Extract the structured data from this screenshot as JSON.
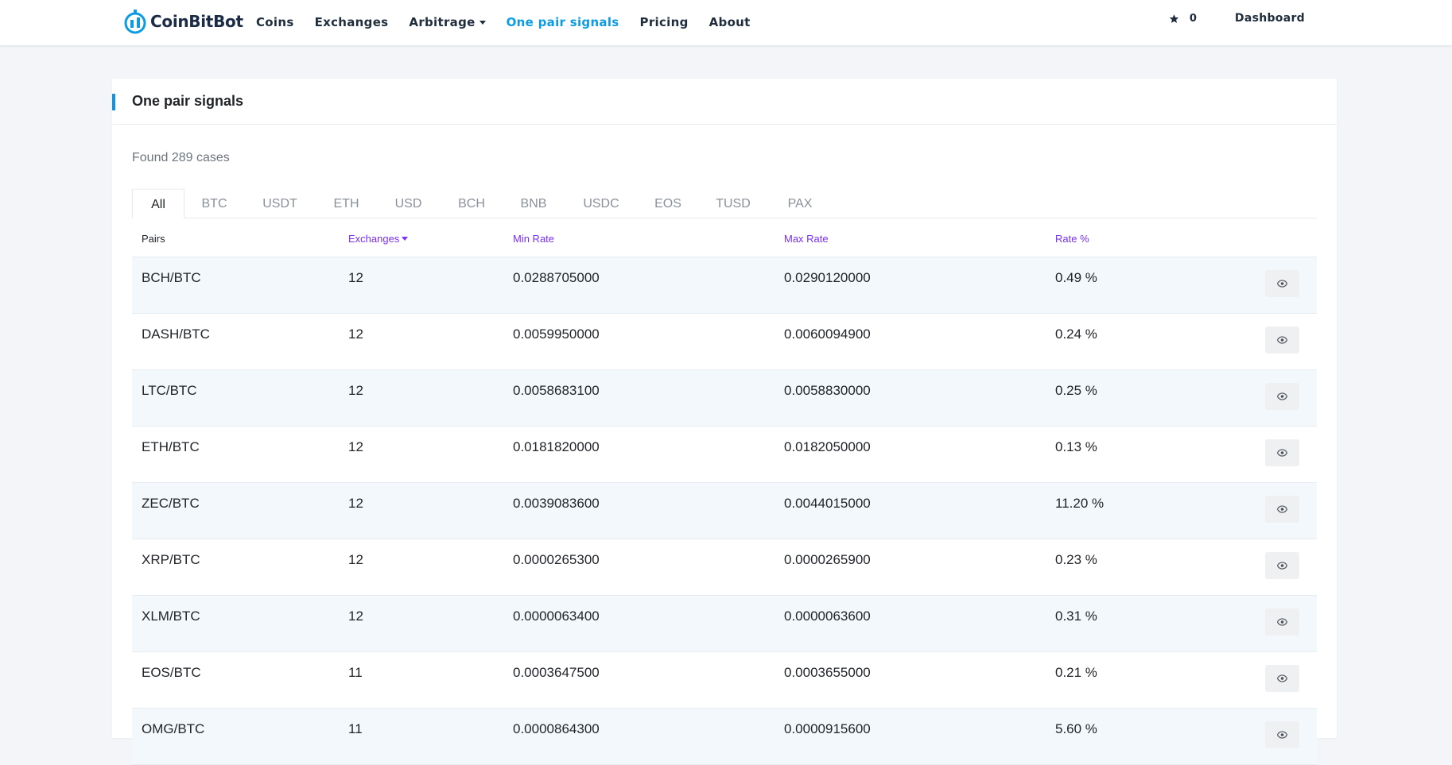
{
  "brand": {
    "name": "CoinBitBot"
  },
  "nav": {
    "coins": "Coins",
    "exchanges": "Exchanges",
    "arbitrage": "Arbitrage",
    "one_pair": "One pair signals",
    "pricing": "Pricing",
    "about": "About"
  },
  "header_right": {
    "favorites_count": "0",
    "dashboard": "Dashboard"
  },
  "page": {
    "title": "One pair signals",
    "found": "Found 289 cases"
  },
  "tabs": [
    "All",
    "BTC",
    "USDT",
    "ETH",
    "USD",
    "BCH",
    "BNB",
    "USDC",
    "EOS",
    "TUSD",
    "PAX"
  ],
  "table": {
    "headers": {
      "pairs": "Pairs",
      "exchanges": "Exchanges",
      "min_rate": "Min Rate",
      "max_rate": "Max Rate",
      "rate_pct": "Rate %"
    },
    "rows": [
      {
        "pair": "BCH/BTC",
        "exchanges": "12",
        "min": "0.0288705000",
        "max": "0.0290120000",
        "pct": "0.49 %"
      },
      {
        "pair": "DASH/BTC",
        "exchanges": "12",
        "min": "0.0059950000",
        "max": "0.0060094900",
        "pct": "0.24 %"
      },
      {
        "pair": "LTC/BTC",
        "exchanges": "12",
        "min": "0.0058683100",
        "max": "0.0058830000",
        "pct": "0.25 %"
      },
      {
        "pair": "ETH/BTC",
        "exchanges": "12",
        "min": "0.0181820000",
        "max": "0.0182050000",
        "pct": "0.13 %"
      },
      {
        "pair": "ZEC/BTC",
        "exchanges": "12",
        "min": "0.0039083600",
        "max": "0.0044015000",
        "pct": "11.20 %"
      },
      {
        "pair": "XRP/BTC",
        "exchanges": "12",
        "min": "0.0000265300",
        "max": "0.0000265900",
        "pct": "0.23 %"
      },
      {
        "pair": "XLM/BTC",
        "exchanges": "12",
        "min": "0.0000063400",
        "max": "0.0000063600",
        "pct": "0.31 %"
      },
      {
        "pair": "EOS/BTC",
        "exchanges": "11",
        "min": "0.0003647500",
        "max": "0.0003655000",
        "pct": "0.21 %"
      },
      {
        "pair": "OMG/BTC",
        "exchanges": "11",
        "min": "0.0000864300",
        "max": "0.0000915600",
        "pct": "5.60 %"
      }
    ]
  },
  "colors": {
    "accent": "#0d9be4",
    "sort_link": "#7a2ff5",
    "row_alt": "#f3f8fc"
  },
  "icons": {
    "view": "eye-icon",
    "favorites": "star-icon",
    "logo": "coinbitbot-logo-icon"
  }
}
